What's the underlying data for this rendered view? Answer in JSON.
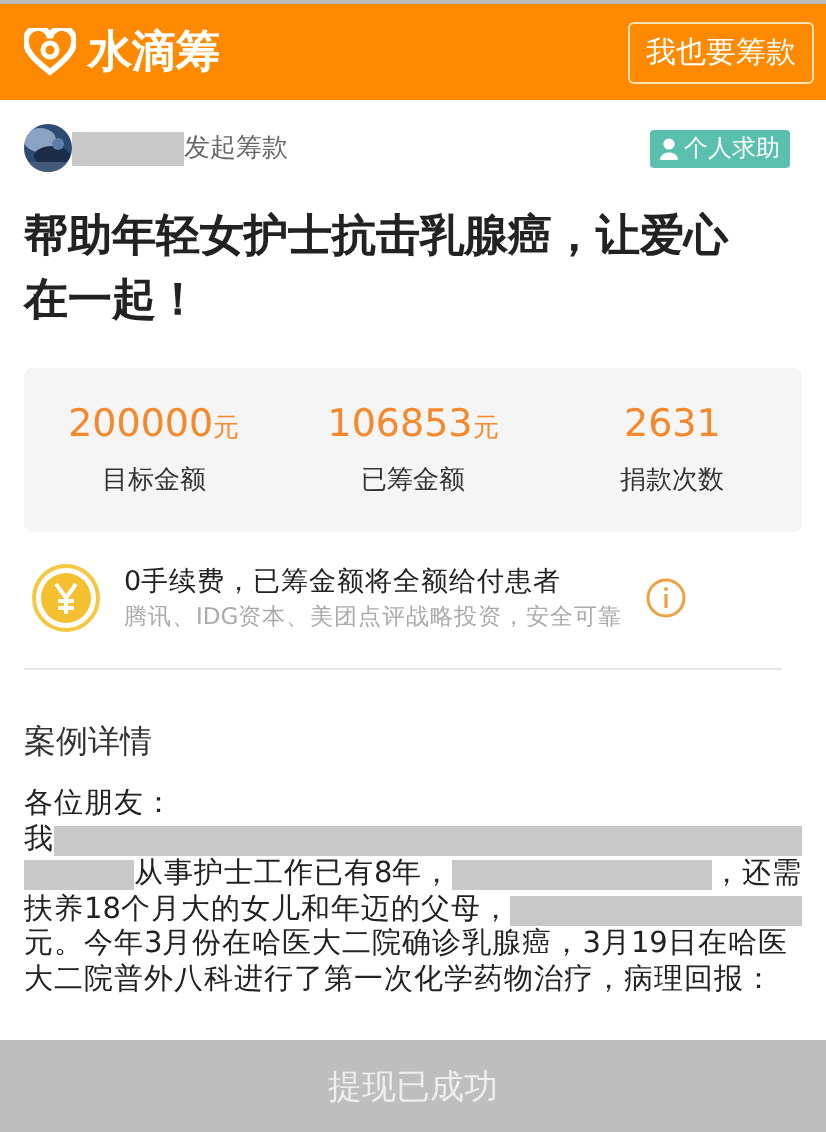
{
  "header": {
    "logo_text": "水滴筹",
    "action_button": "我也要筹款"
  },
  "initiator": {
    "suffix": "发起筹款",
    "tag": "个人求助"
  },
  "title": "帮助年轻女护士抗击乳腺癌，让爱心在一起！",
  "stats": [
    {
      "value": "200000",
      "unit": "元",
      "label": "目标金额"
    },
    {
      "value": "106853",
      "unit": "元",
      "label": "已筹金额"
    },
    {
      "value": "2631",
      "label": "捐款次数"
    }
  ],
  "notice": {
    "headline": "0手续费，已筹金额将全额给付患者",
    "subline": "腾讯、IDG资本、美团点评战略投资，安全可靠"
  },
  "details": {
    "heading": "案例详情",
    "lines": [
      {
        "parts": [
          {
            "kind": "text",
            "text": "各位朋友："
          }
        ]
      },
      {
        "parts": [
          {
            "kind": "text",
            "text": "我"
          },
          {
            "kind": "redacted"
          }
        ]
      },
      {
        "parts": [
          {
            "kind": "redacted"
          },
          {
            "kind": "text",
            "text": "从事护士工作已有8年，"
          },
          {
            "kind": "redacted"
          },
          {
            "kind": "text",
            "text": "，还需"
          }
        ]
      },
      {
        "parts": [
          {
            "kind": "text",
            "text": "扶养18个月大的女儿和年迈的父母，"
          },
          {
            "kind": "redacted"
          }
        ]
      },
      {
        "parts": [
          {
            "kind": "text",
            "text": "元。今年3月份在哈医大二院确诊乳腺癌，3月19日在哈医"
          }
        ]
      },
      {
        "parts": [
          {
            "kind": "text",
            "text": "大二院普外八科进行了第一次化学药物治疗，病理回报："
          }
        ]
      }
    ]
  },
  "bottom_bar": {
    "label": "提现已成功",
    "disabled": true
  }
}
